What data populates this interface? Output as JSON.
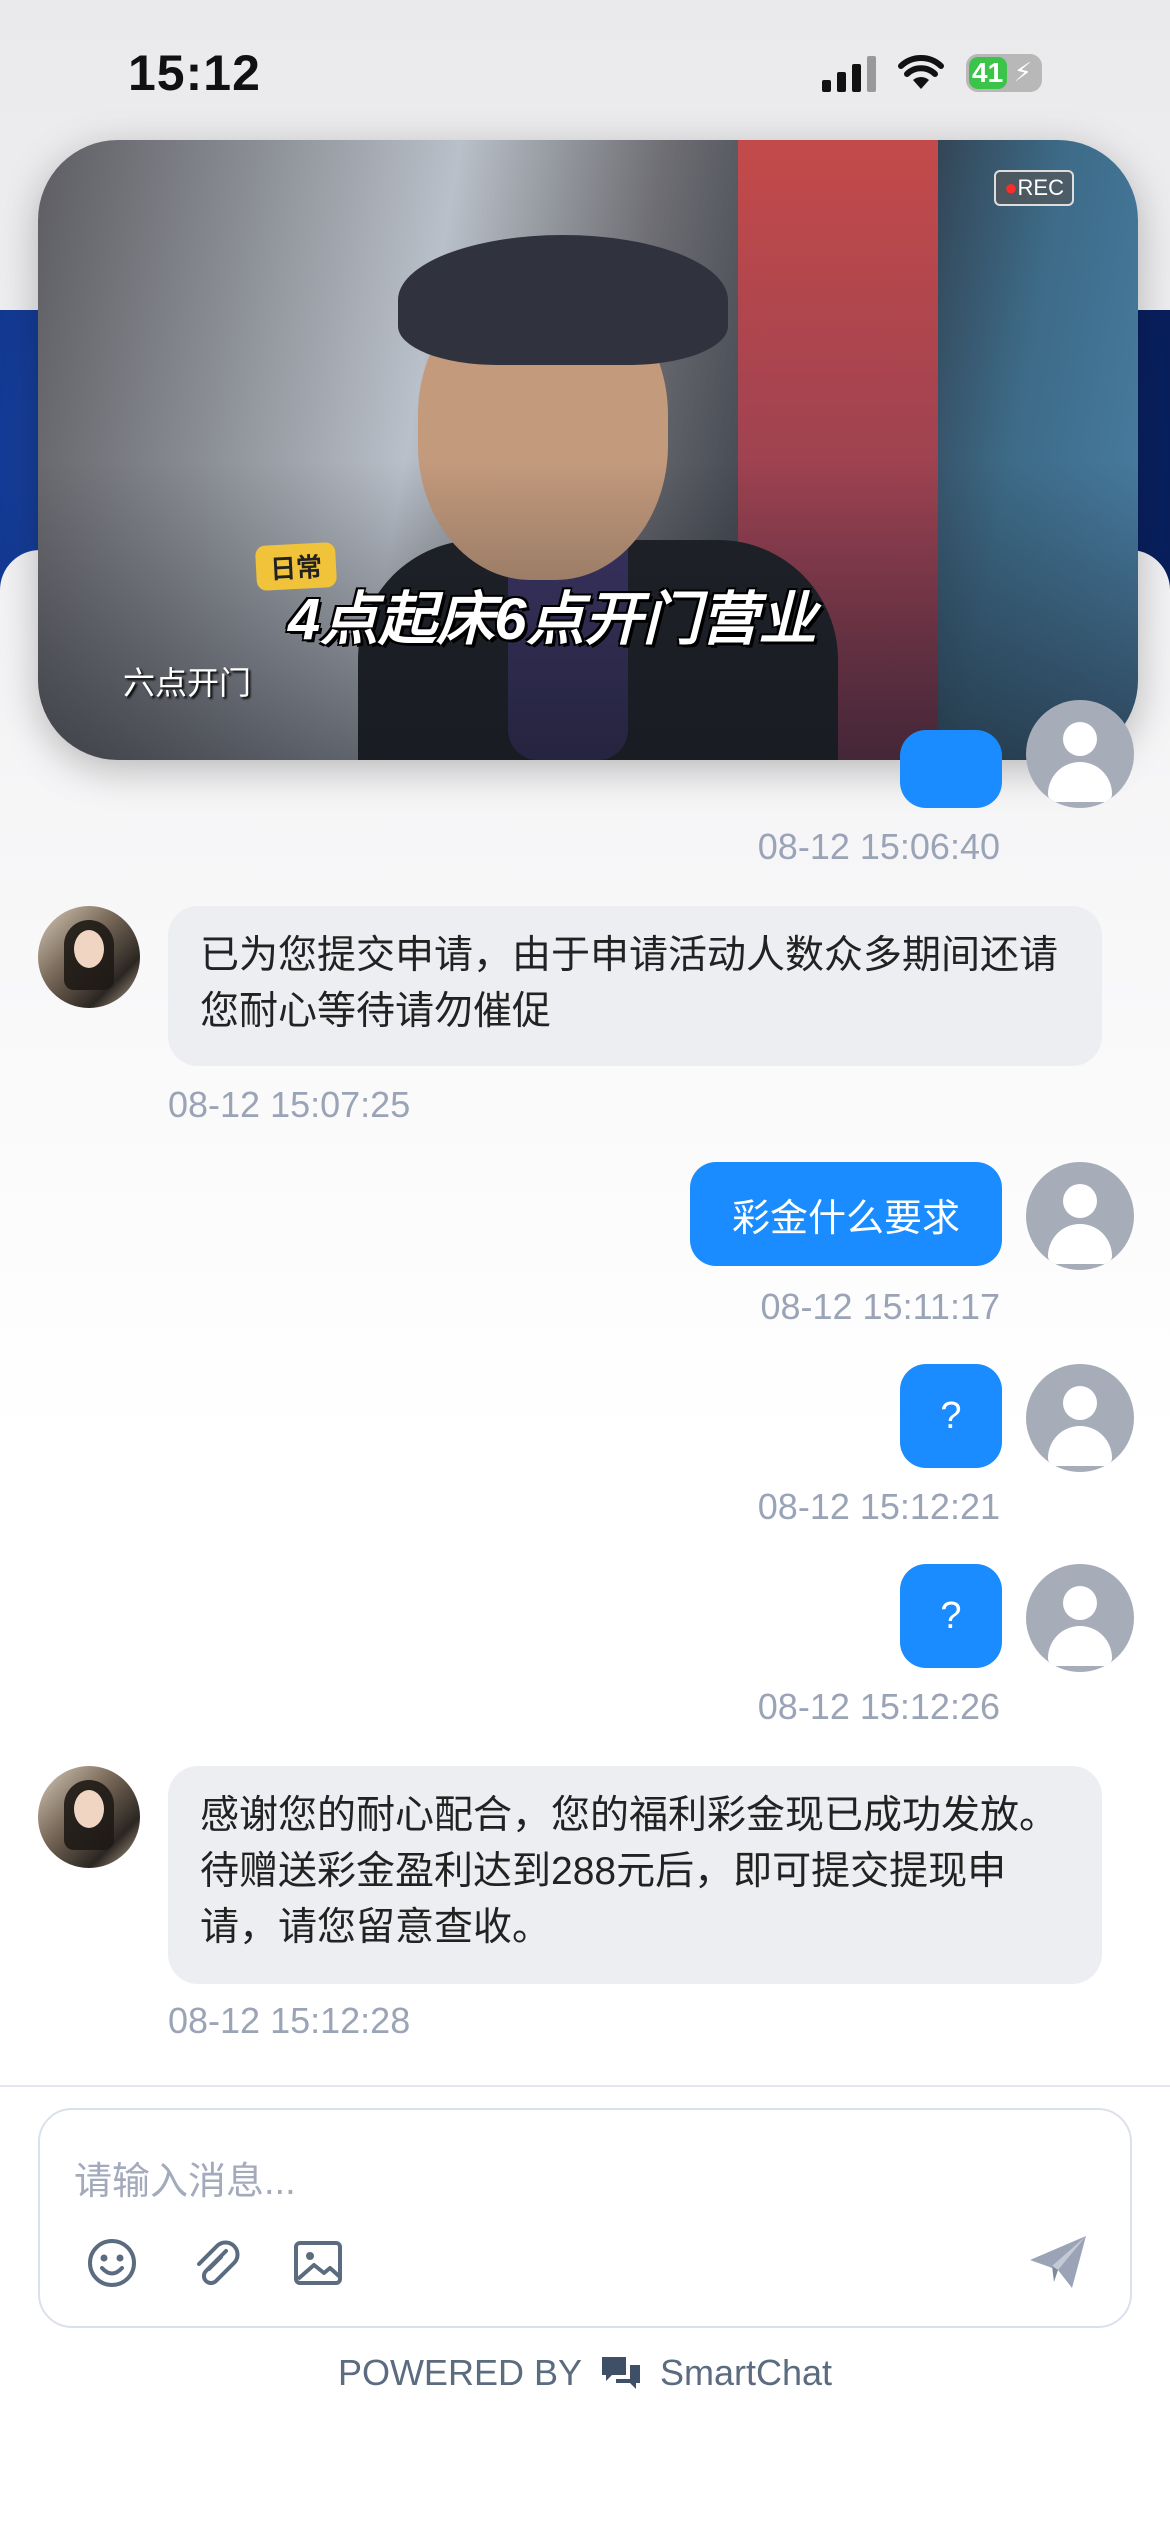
{
  "status_bar": {
    "time": "15:12",
    "battery": "41"
  },
  "video": {
    "rec_label": "REC",
    "tag": "日常",
    "headline": "4点起床6点开门营业",
    "caption": "六点开门"
  },
  "messages": [
    {
      "from": "user",
      "text": "",
      "time": "08-12 15:06:40"
    },
    {
      "from": "agent",
      "text": "已为您提交申请，由于申请活动人数众多期间还请您耐心等待请勿催促",
      "time": "08-12 15:07:25"
    },
    {
      "from": "user",
      "text": "彩金什么要求",
      "time": "08-12 15:11:17"
    },
    {
      "from": "user",
      "text": "?",
      "time": "08-12 15:12:21"
    },
    {
      "from": "user",
      "text": "?",
      "time": "08-12 15:12:26"
    },
    {
      "from": "agent",
      "text": "感谢您的耐心配合，您的福利彩金现已成功发放。待赠送彩金盈利达到288元后，即可提交提现申请，请您留意查收。",
      "time": "08-12 15:12:28"
    }
  ],
  "composer": {
    "placeholder": "请输入消息...",
    "icons": [
      "emoji-icon",
      "attachment-icon",
      "image-icon",
      "send-icon"
    ]
  },
  "footer": {
    "powered_by": "POWERED BY",
    "brand": "SmartChat",
    "icon": "chat-bubbles-icon"
  },
  "colors": {
    "accent": "#1a8cff",
    "agent_bubble": "#eceef1",
    "timestamp": "#9aa4b6"
  }
}
